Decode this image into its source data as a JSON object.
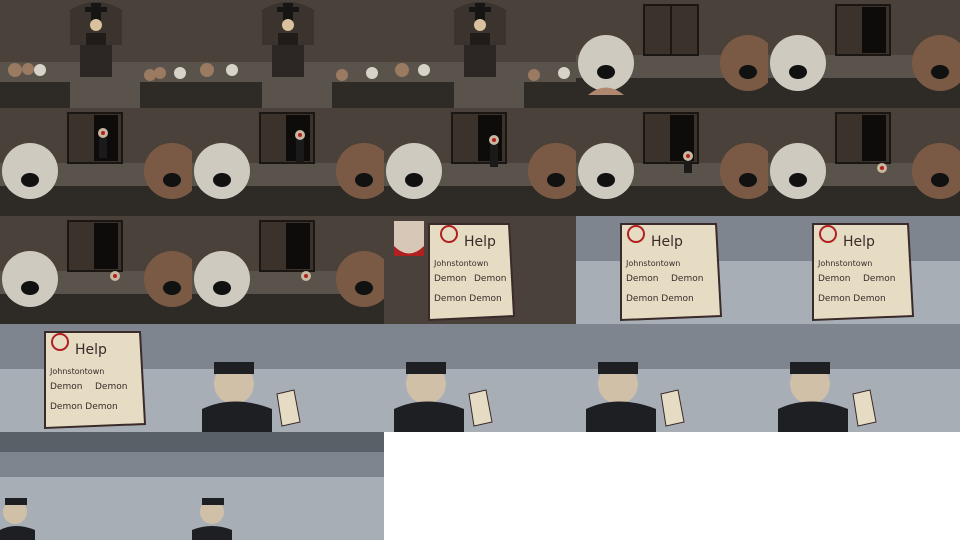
{
  "sheet": {
    "grid": "5x5 storyboard frames",
    "frame_count": 22,
    "background": "#ffffff"
  },
  "palette": {
    "church_wall": "#4a413a",
    "church_floor": "#5a534c",
    "pew": "#2e2a26",
    "pale_mourner": "#cfcac0",
    "brown_mourner": "#7a5a45",
    "doorway_dark": "#0e0c0b",
    "paper": "#e6dcc4",
    "ink": "#3a2a2a",
    "blood": "#b02020",
    "street_sky": "#7e858e",
    "street_ground": "#a8aeb6",
    "coat": "#1d1f22"
  },
  "note": {
    "heading": "Help",
    "line1": "Johnstontown",
    "line2": "Demon",
    "line3": "Demon",
    "line4": "Demon Demon"
  },
  "icons": {
    "cross": "cross-icon",
    "door": "door-icon",
    "paper": "note-icon"
  }
}
